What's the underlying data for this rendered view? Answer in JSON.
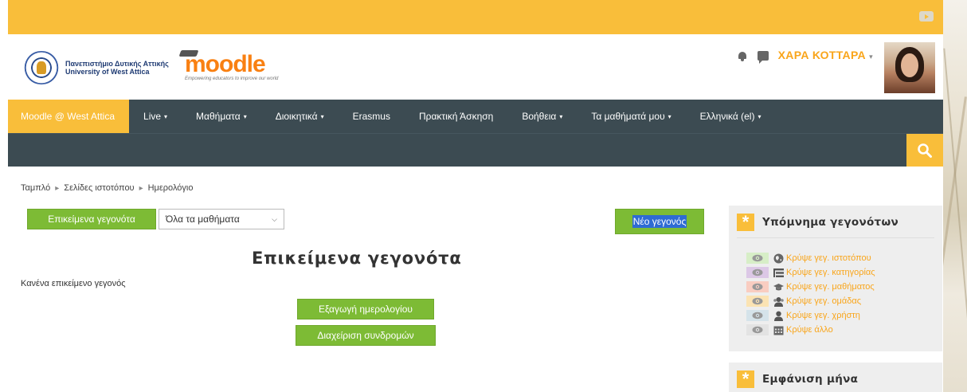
{
  "university": {
    "line1": "Πανεπιστήμιο Δυτικής Αττικής",
    "line2": "University of West Attica"
  },
  "moodle": {
    "word": "moodle",
    "tagline": "Empowering educators to improve our world"
  },
  "user": {
    "name": "ΧΑΡΑ ΚΟΤΤΑΡΑ",
    "caret": "▾"
  },
  "nav": {
    "items": [
      {
        "label": "Moodle @ West Attica",
        "caret": ""
      },
      {
        "label": "Live",
        "caret": "▾"
      },
      {
        "label": "Μαθήματα",
        "caret": "▾"
      },
      {
        "label": "Διοικητικά",
        "caret": "▾"
      },
      {
        "label": "Erasmus",
        "caret": ""
      },
      {
        "label": "Πρακτική Άσκηση",
        "caret": ""
      },
      {
        "label": "Βοήθεια",
        "caret": "▾"
      },
      {
        "label": "Τα μαθήματά μου",
        "caret": "▾"
      },
      {
        "label": "Ελληνικά (el)",
        "caret": "▾"
      }
    ]
  },
  "breadcrumb": {
    "items": [
      "Ταμπλό",
      "Σελίδες ιστοτόπου",
      "Ημερολόγιο"
    ],
    "sep": "▸"
  },
  "controls": {
    "upcoming_label": "Επικείμενα γεγονότα",
    "course_select_value": "Όλα τα μαθήματα",
    "new_event_label": "Νέο γεγονός"
  },
  "main": {
    "title": "Επικείμενα γεγονότα",
    "empty_text": "Κανένα επικείμενο γεγονός",
    "export_label": "Εξαγωγή ημερολογίου",
    "manage_label": "Διαχείριση συνδρομών"
  },
  "legend": {
    "title": "Υπόμνημα γεγονότων",
    "items": [
      {
        "label": "Κρύψε γεγ. ιστοτόπου",
        "icon": "globe-icon",
        "color": "#d7eec7"
      },
      {
        "label": "Κρύψε γεγ. κατηγορίας",
        "icon": "category-icon",
        "color": "#dcc8e6"
      },
      {
        "label": "Κρύψε γεγ. μαθήματος",
        "icon": "graduation-cap-icon",
        "color": "#f9cdc1"
      },
      {
        "label": "Κρύψε γεγ. ομάδας",
        "icon": "group-icon",
        "color": "#fbe3b3"
      },
      {
        "label": "Κρύψε γεγ. χρήστη",
        "icon": "user-icon",
        "color": "#d5e3ea"
      },
      {
        "label": "Κρύψε άλλο",
        "icon": "calendar-icon",
        "color": "#e3e3e3"
      }
    ]
  },
  "month_block": {
    "title": "Εμφάνιση μήνα"
  },
  "colors": {
    "accent": "#f9be3a",
    "nav_bg": "#3c4b52",
    "button_green": "#7dbb35",
    "link_orange": "#f9a51a"
  }
}
